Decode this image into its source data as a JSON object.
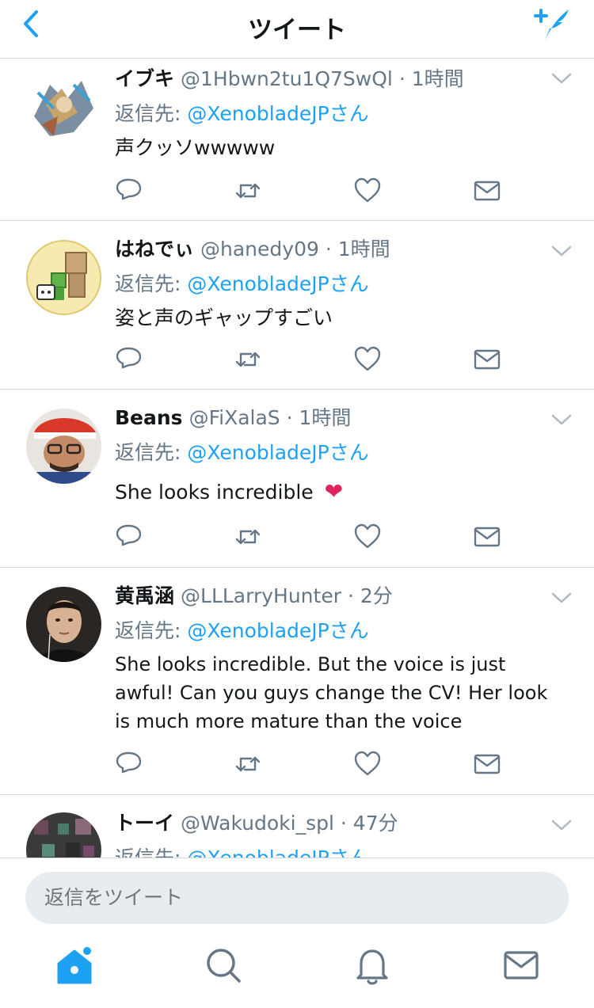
{
  "header": {
    "title": "ツイート"
  },
  "tweets": [
    {
      "name": "イブキ",
      "handle": "@1Hbwn2tu1Q7SwQl",
      "dot": "·",
      "time": "1時間",
      "reply_label": "返信先: ",
      "reply_user": "@XenobladeJPさん",
      "text": "声クッソwwwww"
    },
    {
      "name": "はねでぃ",
      "handle": "@hanedy09",
      "dot": "·",
      "time": "1時間",
      "reply_label": "返信先: ",
      "reply_user": "@XenobladeJPさん",
      "text": "姿と声のギャップすごい"
    },
    {
      "name": "Beans",
      "handle": "@FiXalaS",
      "dot": "·",
      "time": "1時間",
      "reply_label": "返信先: ",
      "reply_user": "@XenobladeJPさん",
      "text": "She looks incredible",
      "emoji": "❤"
    },
    {
      "name": "黄禹涵",
      "handle": "@LLLarryHunter",
      "dot": "·",
      "time": "2分",
      "reply_label": "返信先: ",
      "reply_user": "@XenobladeJPさん",
      "text": "She looks incredible. But the voice is just awful! Can you guys change the CV! Her look is much more mature than the voice"
    },
    {
      "name": "トーイ",
      "handle": "@Wakudoki_spl",
      "dot": "·",
      "time": "47分",
      "reply_label": "返信先: ",
      "reply_user": "@XenobladeJPさん"
    }
  ],
  "reply_bar": {
    "placeholder": "返信をツイート"
  },
  "icons": {
    "back": "chevron-left-icon",
    "compose": "compose-tweet-icon",
    "reply": "reply-icon",
    "retweet": "retweet-icon",
    "like": "heart-icon",
    "dm": "envelope-icon",
    "home": "home-icon",
    "search": "search-icon",
    "notifications": "bell-icon",
    "messages": "envelope-icon"
  },
  "colors": {
    "accent": "#1da1f2",
    "text": "#14171a",
    "secondary": "#657786",
    "divider": "#d7dadd",
    "input_bg": "#e6ecf0",
    "heart": "#e0245e"
  }
}
